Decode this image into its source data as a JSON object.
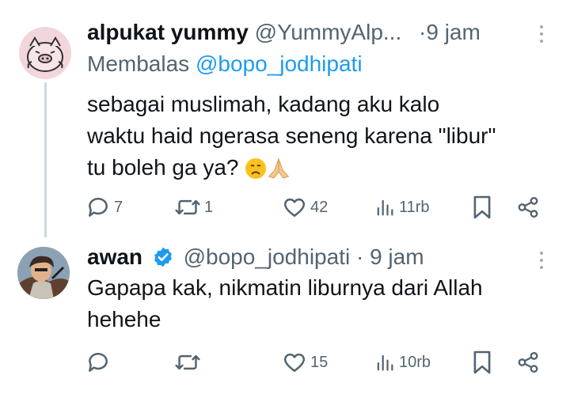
{
  "tweets": [
    {
      "display_name": "alpukat yummy",
      "handle": "@YummyAlp...",
      "separator_time": "·9 jam",
      "reply_prefix": "Membalas",
      "reply_handle": "@bopo_jodhipati",
      "text": "sebagai muslimah, kadang  aku kalo\nwaktu haid ngerasa seneng karena \"libur\"\ntu boleh ga ya?",
      "emojis": [
        "disappointed-face-emoji",
        "folded-hands-emoji"
      ],
      "replies": "7",
      "reposts": "1",
      "likes": "42",
      "views": "11rb"
    },
    {
      "display_name": "awan",
      "verified": true,
      "handle": "@bopo_jodhipati",
      "separator_time": "· 9 jam",
      "text": "Gapapa kak, nikmatin liburnya dari Allah\nhehehe",
      "replies": "",
      "reposts": "",
      "likes": "15",
      "views": "10rb"
    }
  ],
  "colors": {
    "text": "#0f1419",
    "muted": "#536471",
    "link": "#1d9bf0",
    "verified": "#1d9bf0",
    "thread_line": "#cfd9de"
  }
}
